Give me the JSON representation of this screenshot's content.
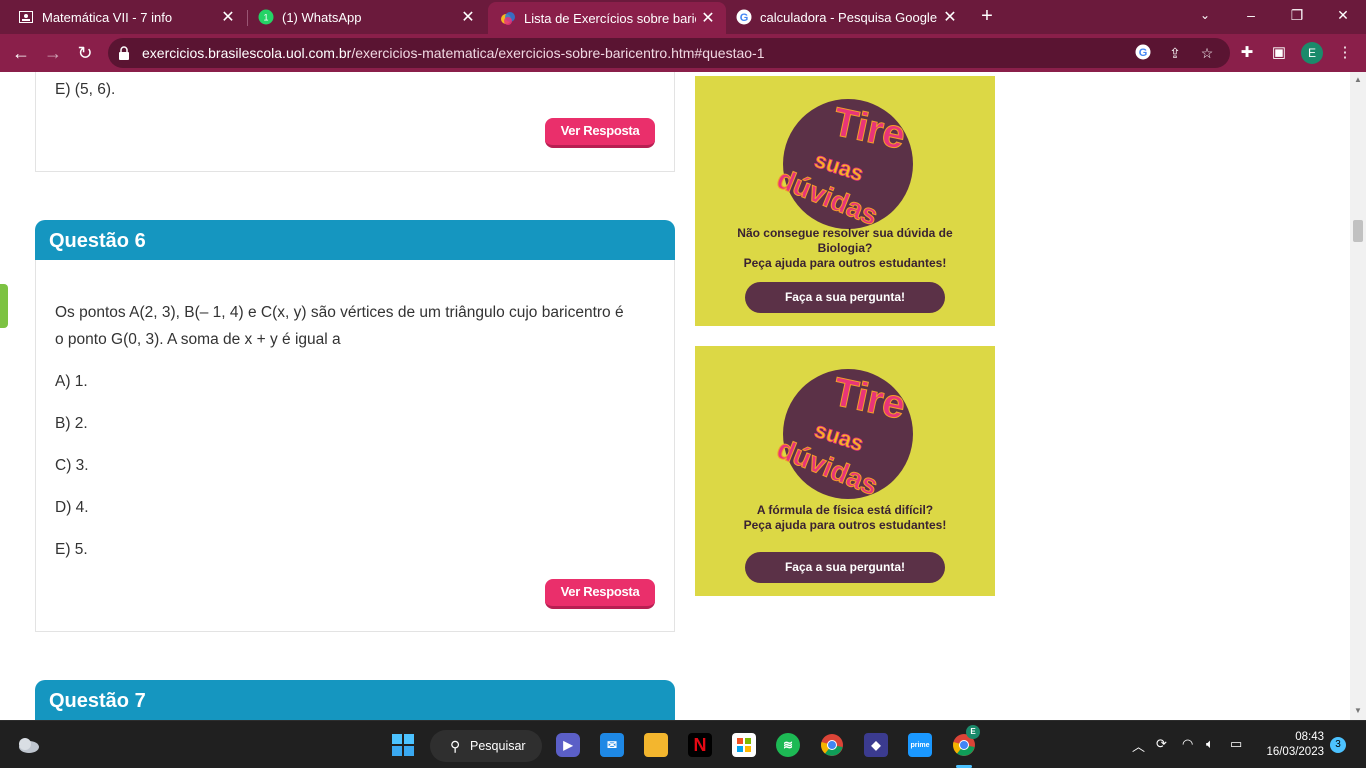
{
  "tabs": [
    {
      "title": "Matemática VII - 7 info",
      "icon": "classroom-icon"
    },
    {
      "title": "(1) WhatsApp",
      "icon": "whatsapp-icon"
    },
    {
      "title": "Lista de Exercícios sobre baricent",
      "icon": "brasil-escola-icon",
      "active": true
    },
    {
      "title": "calculadora - Pesquisa Google",
      "icon": "google-icon"
    }
  ],
  "address": {
    "host": "exercicios.brasilescola.uol.com.br",
    "path": "/exercicios-matematica/exercicios-sobre-baricentro.htm#questao-1"
  },
  "profile_initial": "E",
  "content": {
    "prev_option_e": "E) (5, 6).",
    "ver_resposta": "Ver Resposta",
    "q6": {
      "title": "Questão 6",
      "statement_line1": "Os pontos A(2, 3), B(– 1, 4) e C(x, y) são vértices de um triângulo cujo baricentro é",
      "statement_line2": "o ponto G(0, 3). A soma de x + y é igual a",
      "options": [
        "A) 1.",
        "B) 2.",
        "C) 3.",
        "D) 4.",
        "E) 5."
      ]
    },
    "q7": {
      "title": "Questão 7"
    }
  },
  "ads": [
    {
      "line1": "Não consegue resolver sua dúvida de",
      "line2": "Biologia?",
      "line3": "Peça ajuda para outros estudantes!",
      "button": "Faça a sua pergunta!"
    },
    {
      "line1": "A fórmula de física está difícil?",
      "line2": "Peça ajuda para outros estudantes!",
      "button": "Faça a sua pergunta!"
    }
  ],
  "ad_logo_text": {
    "w1": "Tire",
    "w2": "suas",
    "w3": "dúvidas"
  },
  "taskbar": {
    "search_label": "Pesquisar",
    "time": "08:43",
    "date": "16/03/2023",
    "notifications": "3",
    "chrome_badge": "E"
  },
  "colors": {
    "tab_bar": "#6b1a3c",
    "toolbar": "#8a1f4a",
    "question_header": "#1596c0",
    "answer_button": "#ea2f6b",
    "ad_background": "#dcd845",
    "ad_button": "#5b3147"
  }
}
